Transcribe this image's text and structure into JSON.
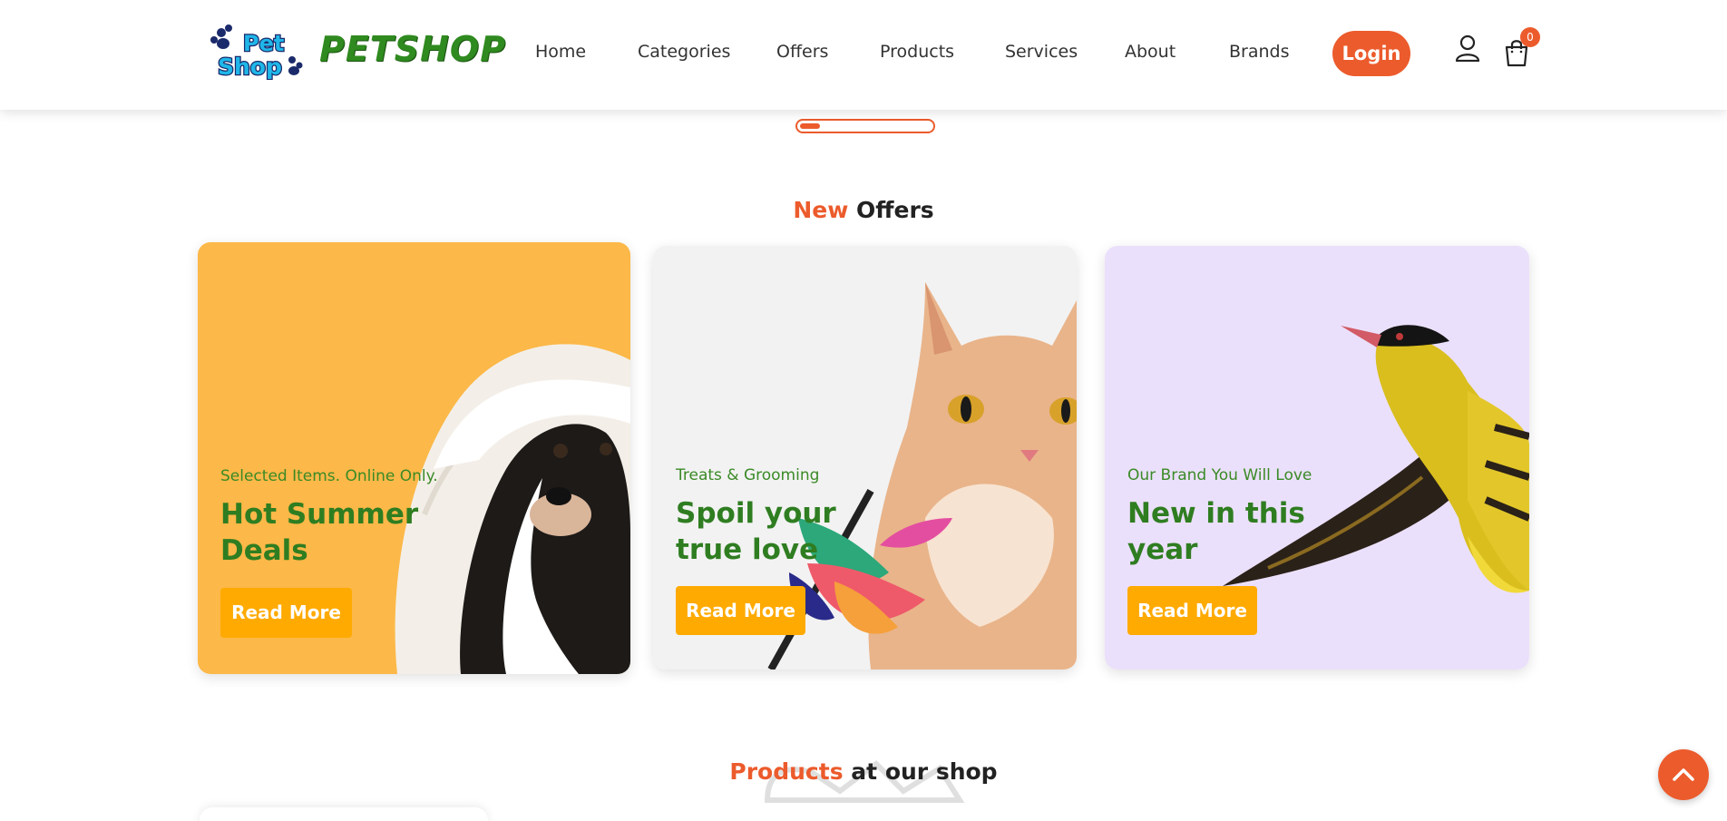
{
  "brand": {
    "logo_text": "PETSHOP",
    "badge_line1": "Pet",
    "badge_line2": "Shop"
  },
  "nav": {
    "items": [
      {
        "label": "Home"
      },
      {
        "label": "Categories"
      },
      {
        "label": "Offers"
      },
      {
        "label": "Products"
      },
      {
        "label": "Services"
      },
      {
        "label": "About"
      },
      {
        "label": "Brands"
      }
    ],
    "login_label": "Login",
    "cart_count": "0"
  },
  "slider": {
    "progress_fraction": 0.15
  },
  "offers_section": {
    "title_accent": "New",
    "title_rest": "Offers"
  },
  "offers": [
    {
      "subtitle": "Selected Items. Online Only.",
      "title": "Hot Summer Deals",
      "button": "Read More",
      "background": "#fcb848",
      "image": "dog-under-blanket"
    },
    {
      "subtitle": "Treats & Grooming",
      "title": "Spoil your true love",
      "button": "Read More",
      "background": "#f2f2f2",
      "image": "cat-with-feather-toy"
    },
    {
      "subtitle": "Our Brand You Will Love",
      "title": "New in this year",
      "button": "Read More",
      "background": "#ebe0fb",
      "image": "yellow-bird-flying"
    }
  ],
  "products_section": {
    "title_accent": "Products",
    "title_rest": "at our shop"
  },
  "colors": {
    "accent": "#ec5b2c",
    "button": "#ffaa00",
    "green": "#2f7d21"
  },
  "icons": {
    "user": "user-icon",
    "cart": "shopping-bag-icon",
    "scroll_top": "chevron-up-icon"
  }
}
